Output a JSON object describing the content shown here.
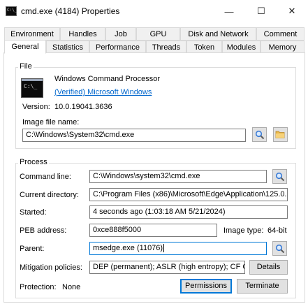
{
  "window": {
    "title": "cmd.exe (4184) Properties",
    "icon_glyph": "C:\\_",
    "minimize_glyph": "—",
    "maximize_glyph": "☐",
    "close_glyph": "✕"
  },
  "tabs_row1": [
    {
      "label": "Environment"
    },
    {
      "label": "Handles"
    },
    {
      "label": "Job"
    },
    {
      "label": "GPU"
    },
    {
      "label": "Disk and Network"
    },
    {
      "label": "Comment"
    }
  ],
  "tabs_row2": [
    {
      "label": "General",
      "active": true
    },
    {
      "label": "Statistics"
    },
    {
      "label": "Performance"
    },
    {
      "label": "Threads"
    },
    {
      "label": "Token"
    },
    {
      "label": "Modules"
    },
    {
      "label": "Memory"
    }
  ],
  "file": {
    "group_title": "File",
    "description": "Windows Command Processor",
    "company": "(Verified) Microsoft Windows",
    "version_label": "Version:",
    "version_value": "10.0.19041.3636",
    "image_label": "Image file name:",
    "image_value": "C:\\Windows\\System32\\cmd.exe"
  },
  "process": {
    "group_title": "Process",
    "cmdline_label": "Command line:",
    "cmdline_value": "C:\\Windows\\system32\\cmd.exe",
    "curdir_label": "Current directory:",
    "curdir_value": "C:\\Program Files (x86)\\Microsoft\\Edge\\Application\\125.0.",
    "started_label": "Started:",
    "started_value": "4 seconds ago (1:03:18 AM 5/21/2024)",
    "peb_label": "PEB address:",
    "peb_value": "0xce888f5000",
    "imagetype_label": "Image type:",
    "imagetype_value": "64-bit",
    "parent_label": "Parent:",
    "parent_value": "msedge.exe (11076)",
    "mitigation_label": "Mitigation policies:",
    "mitigation_value": "DEP (permanent); ASLR (high entropy); CF G",
    "details_button": "Details",
    "protection_label": "Protection:",
    "protection_value": "None",
    "permissions_button": "Permissions",
    "terminate_button": "Terminate"
  },
  "colors": {
    "link": "#0066cc",
    "focus_border": "#0078d7",
    "folder_icon": "#e8b84a",
    "magnifier_icon": "#3a7bd5"
  }
}
